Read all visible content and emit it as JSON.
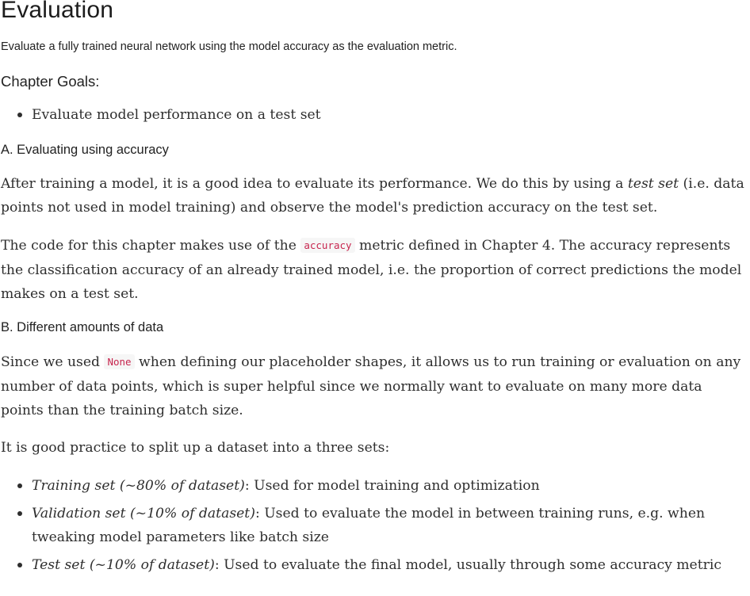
{
  "title": "Evaluation",
  "subtitle": "Evaluate a fully trained neural network using the model accuracy as the evaluation metric.",
  "goals": {
    "heading": "Chapter Goals:",
    "items": [
      "Evaluate model performance on a test set"
    ]
  },
  "section_a": {
    "heading": "A. Evaluating using accuracy",
    "p1": {
      "before": "After training a model, it is a good idea to evaluate its performance. We do this by using a ",
      "em": "test set",
      "after": " (i.e. data points not used in model training) and observe the model's prediction accuracy on the test set."
    },
    "p2": {
      "before": "The code for this chapter makes use of the ",
      "code": "accuracy",
      "after": " metric defined in Chapter 4. The accuracy represents the classification accuracy of an already trained model, i.e. the proportion of correct predictions the model makes on a test set."
    }
  },
  "section_b": {
    "heading": "B. Different amounts of data",
    "p1": {
      "before": "Since we used ",
      "code": "None",
      "after": " when defining our placeholder shapes, it allows us to run training or evaluation on any number of data points, which is super helpful since we normally want to evaluate on many more data points than the training batch size."
    },
    "p2": "It is good practice to split up a dataset into a three sets:",
    "splits": [
      {
        "em": "Training set (~80% of dataset)",
        "rest": ": Used for model training and optimization"
      },
      {
        "em": "Validation set (~10% of dataset)",
        "rest": ": Used to evaluate the model in between training runs, e.g. when tweaking model parameters like batch size"
      },
      {
        "em": "Test set (~10% of dataset)",
        "rest": ": Used to evaluate the final model, usually through some accuracy metric"
      }
    ]
  }
}
